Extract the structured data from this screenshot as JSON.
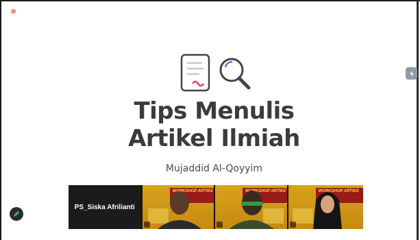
{
  "slide": {
    "title_line1": "Tips Menulis",
    "title_line2": "Artikel Ilmiah",
    "author": "Mujaddid Al-Qoyyim"
  },
  "participants": {
    "name_tile": "PS_Siska Afrilianti",
    "video_tiles": [
      {
        "id": "participant-1",
        "banner": "WORKSHOP ARTIKE"
      },
      {
        "id": "participant-2",
        "banner": "WORKSHOP ARTIKE"
      },
      {
        "id": "participant-3",
        "banner": "WORKSHOP ARTIKE"
      }
    ]
  },
  "icons": {
    "recording": "recording-dot-icon",
    "document": "document-icon",
    "magnifier": "magnifier-icon",
    "side_button": "share-icon",
    "pen_button": "pen-icon"
  },
  "colors": {
    "title": "#3b3b3b",
    "accent_pink": "#e05a7a",
    "banner_red": "#9a1a16",
    "tile_gold": "#d8a21a"
  }
}
